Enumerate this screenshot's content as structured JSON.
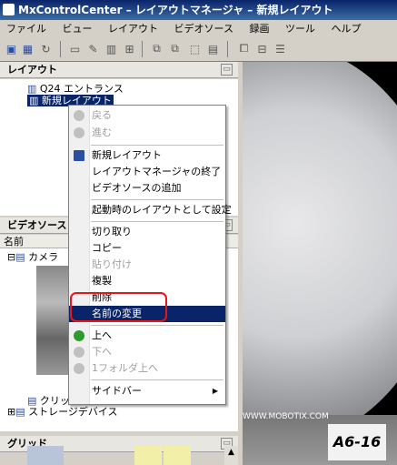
{
  "window": {
    "title": "MxControlCenter – レイアウトマネージャ – 新規レイアウト"
  },
  "menubar": [
    "ファイル",
    "ビュー",
    "レイアウト",
    "ビデオソース",
    "録画",
    "ツール",
    "ヘルプ"
  ],
  "layout_panel": {
    "title": "レイアウト",
    "items": [
      "Q24 エントランス",
      "新規レイアウト"
    ]
  },
  "video_panel": {
    "title": "ビデオソース",
    "column": "名前",
    "items": [
      "カメラ",
      "クリップ",
      "ストレージデバイス"
    ]
  },
  "grid_panel": {
    "title": "グリッド"
  },
  "context_menu": {
    "items": [
      {
        "label": "戻る",
        "disabled": true,
        "icon": "back-icon"
      },
      {
        "label": "進む",
        "disabled": true,
        "icon": "forward-icon"
      },
      {
        "label": "新規レイアウト",
        "disabled": false,
        "icon": "new-layout-icon"
      },
      {
        "label": "レイアウトマネージャの終了",
        "disabled": false
      },
      {
        "label": "ビデオソースの追加",
        "disabled": false
      },
      {
        "label": "起動時のレイアウトとして設定",
        "disabled": false
      },
      {
        "label": "切り取り",
        "disabled": false
      },
      {
        "label": "コピー",
        "disabled": false
      },
      {
        "label": "貼り付け",
        "disabled": true
      },
      {
        "label": "複製",
        "disabled": false
      },
      {
        "label": "削除",
        "disabled": false
      },
      {
        "label": "名前の変更",
        "disabled": false,
        "highlighted": true
      },
      {
        "label": "上へ",
        "disabled": false,
        "icon": "up-arrow-icon"
      },
      {
        "label": "下へ",
        "disabled": true,
        "icon": "down-arrow-icon"
      },
      {
        "label": "1フォルダ上へ",
        "disabled": true,
        "icon": "folder-up-icon"
      },
      {
        "label": "サイドバー",
        "disabled": false,
        "submenu": true
      }
    ]
  },
  "video_overlay": {
    "sign_text": "A6-16",
    "caption": "WWW.MOBOTIX.COM"
  },
  "colors": {
    "highlight": "#0a246a",
    "annotation": "#e8151b",
    "green_icon": "#2e9a2e"
  }
}
